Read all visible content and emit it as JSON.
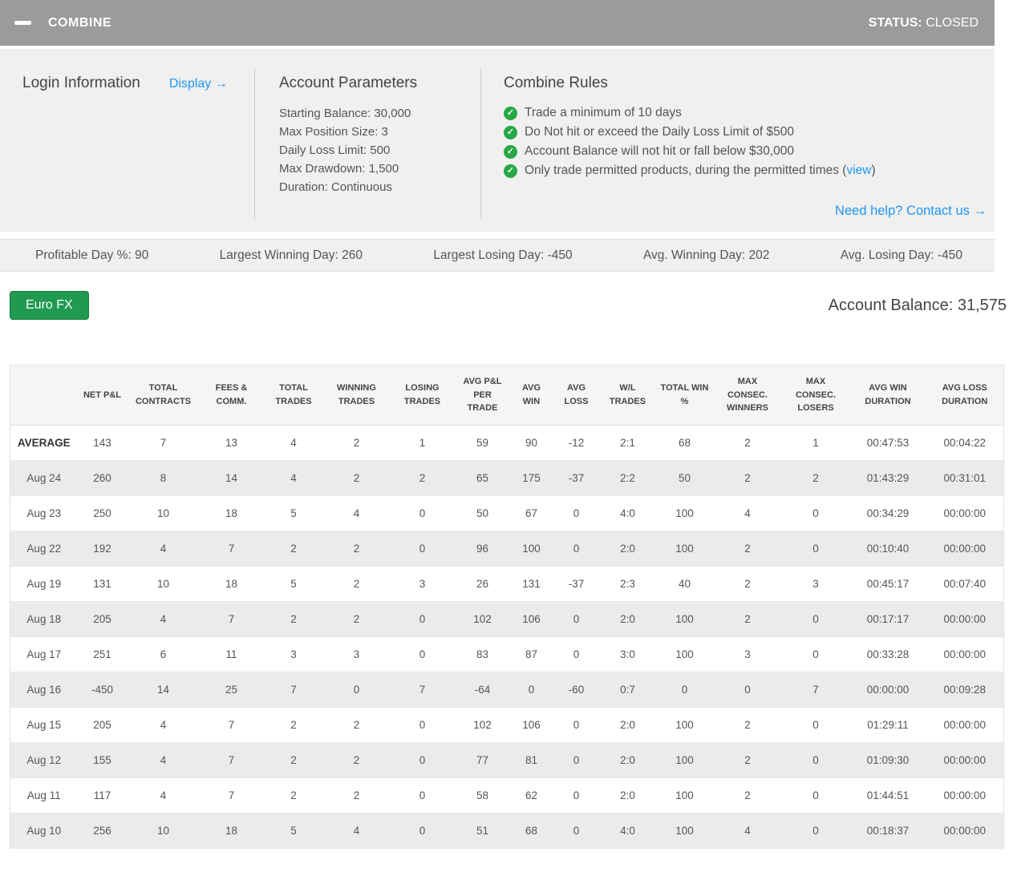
{
  "header": {
    "title": "COMBINE",
    "status_label": "STATUS:",
    "status_value": "CLOSED"
  },
  "panel": {
    "login": {
      "title": "Login Information",
      "display_link": "Display →"
    },
    "account_parameters": {
      "title": "Account Parameters",
      "items": [
        "Starting Balance: 30,000",
        "Max Position Size: 3",
        "Daily Loss Limit: 500",
        "Max Drawdown: 1,500",
        "Duration: Continuous"
      ]
    },
    "combine_rules": {
      "title": "Combine Rules",
      "rules": [
        {
          "prefix": "Trade a minimum of 10 days",
          "link": "",
          "suffix": ""
        },
        {
          "prefix": "Do Not hit or exceed the Daily Loss Limit of $500",
          "link": "",
          "suffix": ""
        },
        {
          "prefix": "Account Balance will not hit or fall below $30,000",
          "link": "",
          "suffix": ""
        },
        {
          "prefix": "Only trade permitted products, during the permitted times (",
          "link": "view",
          "suffix": ")"
        }
      ]
    },
    "help_link": "Need help? Contact us →"
  },
  "stats": [
    "Profitable Day %: 90",
    "Largest Winning Day: 260",
    "Largest Losing Day: -450",
    "Avg. Winning Day: 202",
    "Avg. Losing Day: -450"
  ],
  "toolbar": {
    "instrument_button": "Euro FX",
    "account_balance": "Account Balance: 31,575"
  },
  "table": {
    "columns": [
      "",
      "NET P&L",
      "TOTAL CONTRACTS",
      "FEES & COMM.",
      "TOTAL TRADES",
      "WINNING TRADES",
      "LOSING TRADES",
      "AVG P&L PER TRADE",
      "AVG WIN",
      "AVG LOSS",
      "W/L TRADES",
      "TOTAL WIN %",
      "MAX CONSEC. WINNERS",
      "MAX CONSEC. LOSERS",
      "AVG WIN DURATION",
      "AVG LOSS DURATION"
    ],
    "rows": [
      {
        "label": "AVERAGE",
        "bold": true,
        "cells": [
          "143",
          "7",
          "13",
          "4",
          "2",
          "1",
          "59",
          "90",
          "-12",
          "2:1",
          "68",
          "2",
          "1",
          "00:47:53",
          "00:04:22"
        ]
      },
      {
        "label": "Aug 24",
        "bold": false,
        "cells": [
          "260",
          "8",
          "14",
          "4",
          "2",
          "2",
          "65",
          "175",
          "-37",
          "2:2",
          "50",
          "2",
          "2",
          "01:43:29",
          "00:31:01"
        ]
      },
      {
        "label": "Aug 23",
        "bold": false,
        "cells": [
          "250",
          "10",
          "18",
          "5",
          "4",
          "0",
          "50",
          "67",
          "0",
          "4:0",
          "100",
          "4",
          "0",
          "00:34:29",
          "00:00:00"
        ]
      },
      {
        "label": "Aug 22",
        "bold": false,
        "cells": [
          "192",
          "4",
          "7",
          "2",
          "2",
          "0",
          "96",
          "100",
          "0",
          "2:0",
          "100",
          "2",
          "0",
          "00:10:40",
          "00:00:00"
        ]
      },
      {
        "label": "Aug 19",
        "bold": false,
        "cells": [
          "131",
          "10",
          "18",
          "5",
          "2",
          "3",
          "26",
          "131",
          "-37",
          "2:3",
          "40",
          "2",
          "3",
          "00:45:17",
          "00:07:40"
        ]
      },
      {
        "label": "Aug 18",
        "bold": false,
        "cells": [
          "205",
          "4",
          "7",
          "2",
          "2",
          "0",
          "102",
          "106",
          "0",
          "2:0",
          "100",
          "2",
          "0",
          "00:17:17",
          "00:00:00"
        ]
      },
      {
        "label": "Aug 17",
        "bold": false,
        "cells": [
          "251",
          "6",
          "11",
          "3",
          "3",
          "0",
          "83",
          "87",
          "0",
          "3:0",
          "100",
          "3",
          "0",
          "00:33:28",
          "00:00:00"
        ]
      },
      {
        "label": "Aug 16",
        "bold": false,
        "cells": [
          "-450",
          "14",
          "25",
          "7",
          "0",
          "7",
          "-64",
          "0",
          "-60",
          "0:7",
          "0",
          "0",
          "7",
          "00:00:00",
          "00:09:28"
        ]
      },
      {
        "label": "Aug 15",
        "bold": false,
        "cells": [
          "205",
          "4",
          "7",
          "2",
          "2",
          "0",
          "102",
          "106",
          "0",
          "2:0",
          "100",
          "2",
          "0",
          "01:29:11",
          "00:00:00"
        ]
      },
      {
        "label": "Aug 12",
        "bold": false,
        "cells": [
          "155",
          "4",
          "7",
          "2",
          "2",
          "0",
          "77",
          "81",
          "0",
          "2:0",
          "100",
          "2",
          "0",
          "01:09:30",
          "00:00:00"
        ]
      },
      {
        "label": "Aug 11",
        "bold": false,
        "cells": [
          "117",
          "4",
          "7",
          "2",
          "2",
          "0",
          "58",
          "62",
          "0",
          "2:0",
          "100",
          "2",
          "0",
          "01:44:51",
          "00:00:00"
        ]
      },
      {
        "label": "Aug 10",
        "bold": false,
        "cells": [
          "256",
          "10",
          "18",
          "5",
          "4",
          "0",
          "51",
          "68",
          "0",
          "4:0",
          "100",
          "4",
          "0",
          "00:18:37",
          "00:00:00"
        ]
      }
    ]
  },
  "icons": {
    "collapse": "minus-icon",
    "rule_check": "check-icon"
  },
  "colors": {
    "titlebar_gray": "#9b9b9b",
    "panel_gray": "#f0f0ef",
    "link_blue": "#2196f3",
    "check_green": "#27a844",
    "button_green": "#1f9a50",
    "row_stripe": "#ebebeb"
  }
}
